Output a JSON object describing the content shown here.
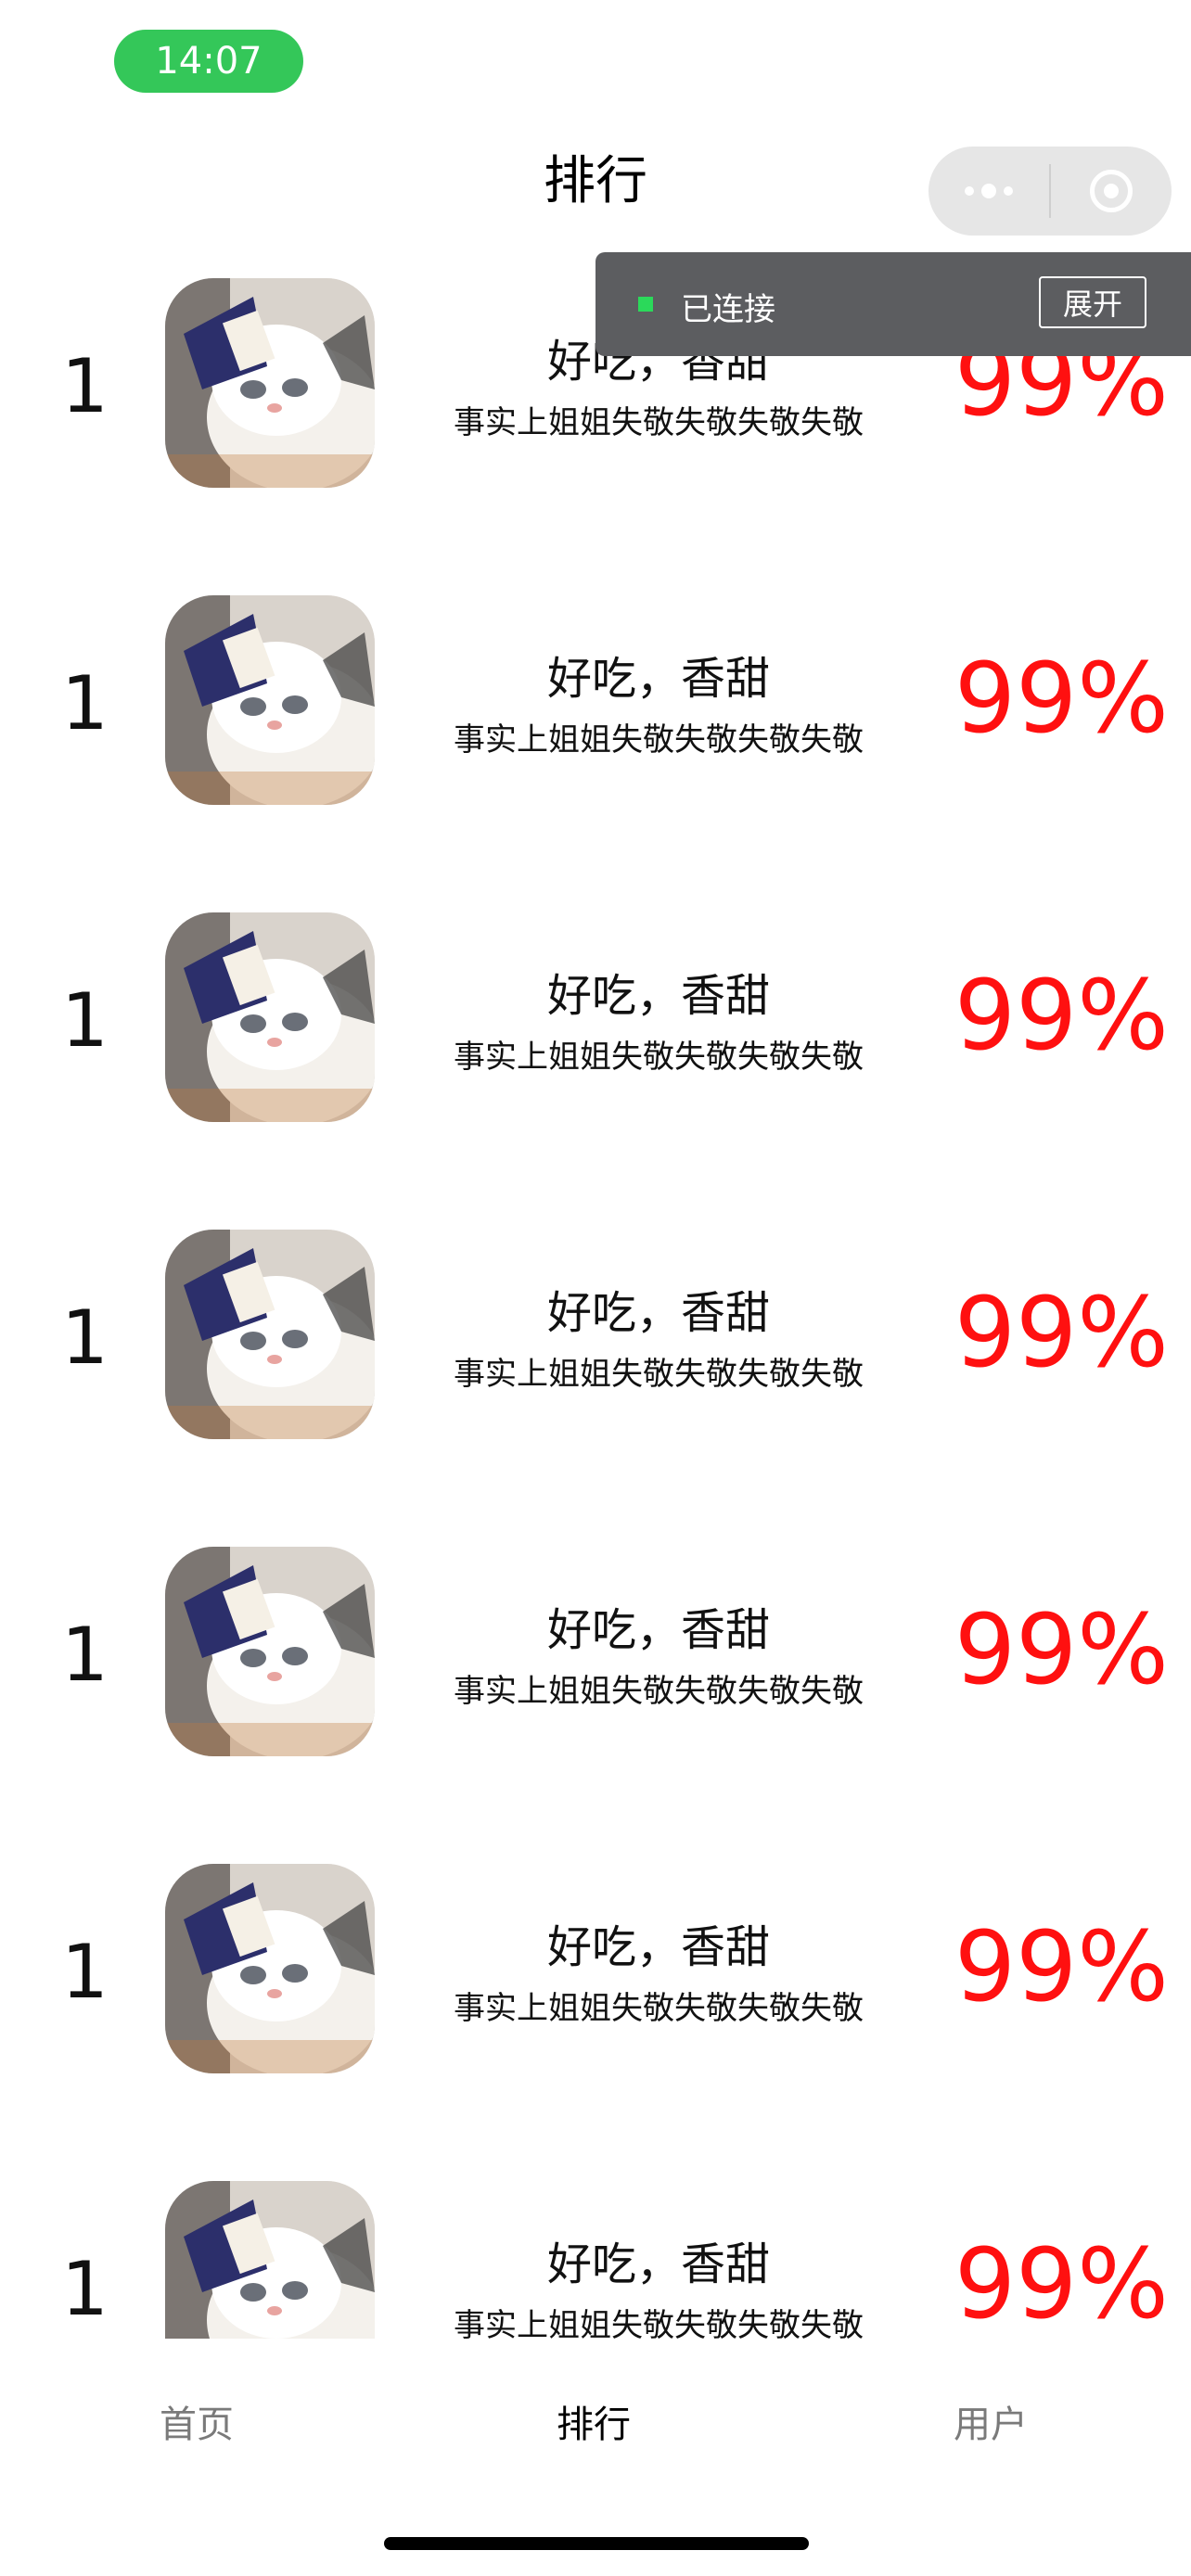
{
  "status": {
    "time": "14:07"
  },
  "nav": {
    "title": "排行"
  },
  "debug": {
    "status_text": "已连接",
    "expand_label": "展开"
  },
  "list": {
    "items": [
      {
        "rank": "1",
        "title": "好吃，香甜",
        "desc": "事实上姐姐失敬失敬失敬失敬",
        "percent": "99%"
      },
      {
        "rank": "1",
        "title": "好吃，香甜",
        "desc": "事实上姐姐失敬失敬失敬失敬",
        "percent": "99%"
      },
      {
        "rank": "1",
        "title": "好吃，香甜",
        "desc": "事实上姐姐失敬失敬失敬失敬",
        "percent": "99%"
      },
      {
        "rank": "1",
        "title": "好吃，香甜",
        "desc": "事实上姐姐失敬失敬失敬失敬",
        "percent": "99%"
      },
      {
        "rank": "1",
        "title": "好吃，香甜",
        "desc": "事实上姐姐失敬失敬失敬失敬",
        "percent": "99%"
      },
      {
        "rank": "1",
        "title": "好吃，香甜",
        "desc": "事实上姐姐失敬失敬失敬失敬",
        "percent": "99%"
      },
      {
        "rank": "1",
        "title": "好吃，香甜",
        "desc": "事实上姐姐失敬失敬失敬失敬",
        "percent": "99%"
      }
    ]
  },
  "tabbar": {
    "home_label": "首页",
    "rank_label": "排行",
    "user_label": "用户",
    "active_color": "#000000",
    "inactive_color": "#7a7a7a"
  },
  "colors": {
    "status_green": "#34c759",
    "percent_red": "#ff1010",
    "debug_bg": "#5c5d60",
    "debug_indicator": "#2bd95a"
  }
}
